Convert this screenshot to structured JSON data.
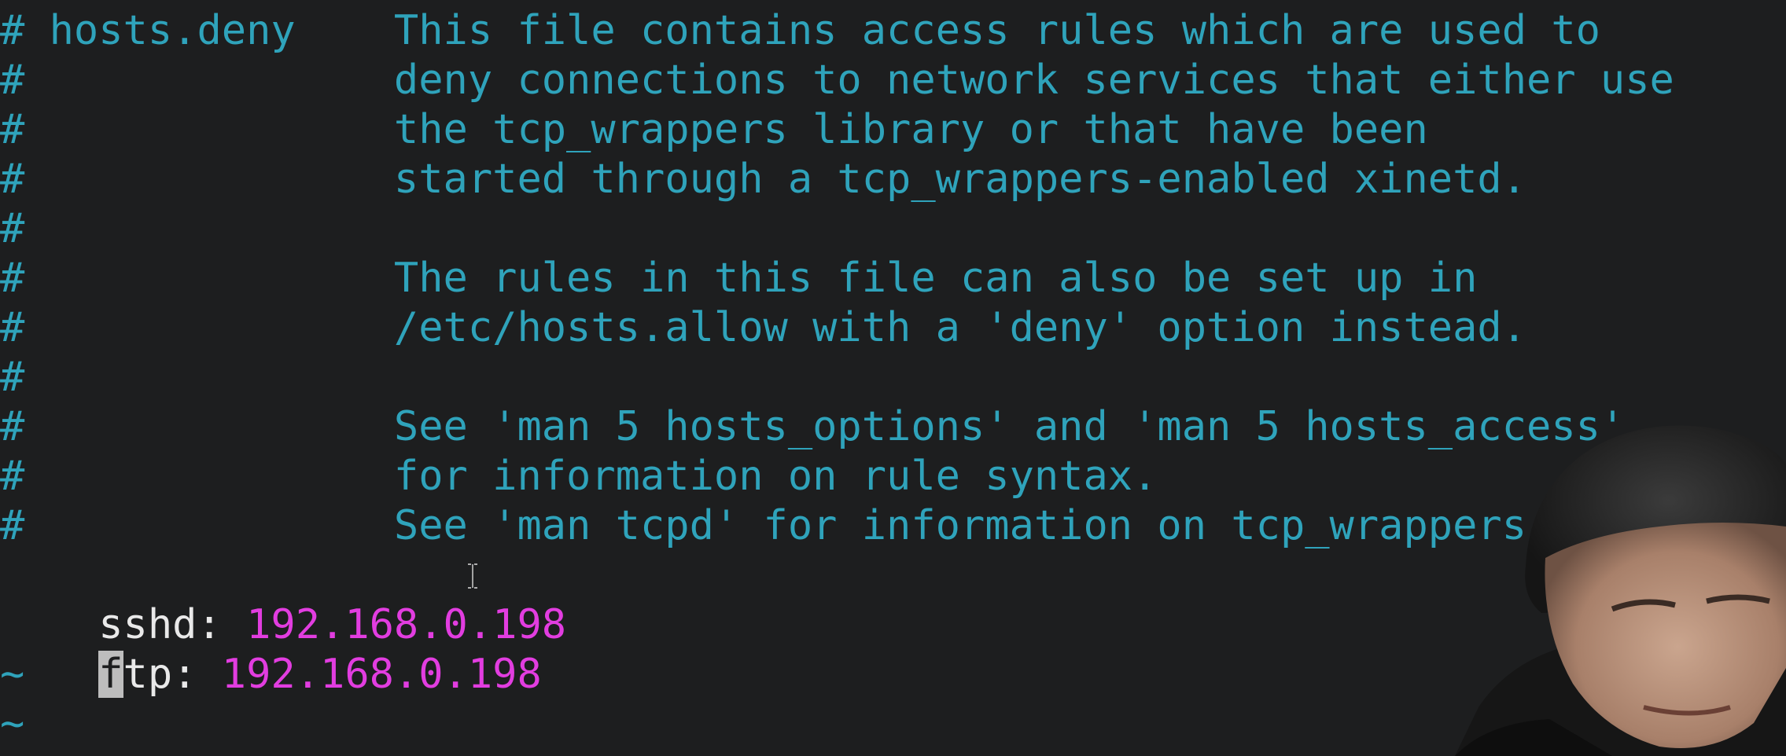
{
  "editor": {
    "comment_lines": [
      "# hosts.deny    This file contains access rules which are used to",
      "#               deny connections to network services that either use",
      "#               the tcp_wrappers library or that have been",
      "#               started through a tcp_wrappers-enabled xinetd.",
      "#",
      "#               The rules in this file can also be set up in",
      "#               /etc/hosts.allow with a 'deny' option instead.",
      "#",
      "#               See 'man 5 hosts_options' and 'man 5 hosts_access'",
      "#               for information on rule syntax.",
      "#               See 'man tcpd' for information on tcp_wrappers"
    ],
    "rules": [
      {
        "service": "sshd:",
        "ip": "192.168.0.198"
      },
      {
        "service_cursor_char": "f",
        "service_rest": "tp:",
        "ip": "192.168.0.198"
      }
    ],
    "empty_line_marker": "~"
  },
  "colors": {
    "background": "#1d1e1f",
    "comment": "#2fa3bb",
    "ip_address": "#e23de0",
    "text": "#e9e9e9"
  }
}
